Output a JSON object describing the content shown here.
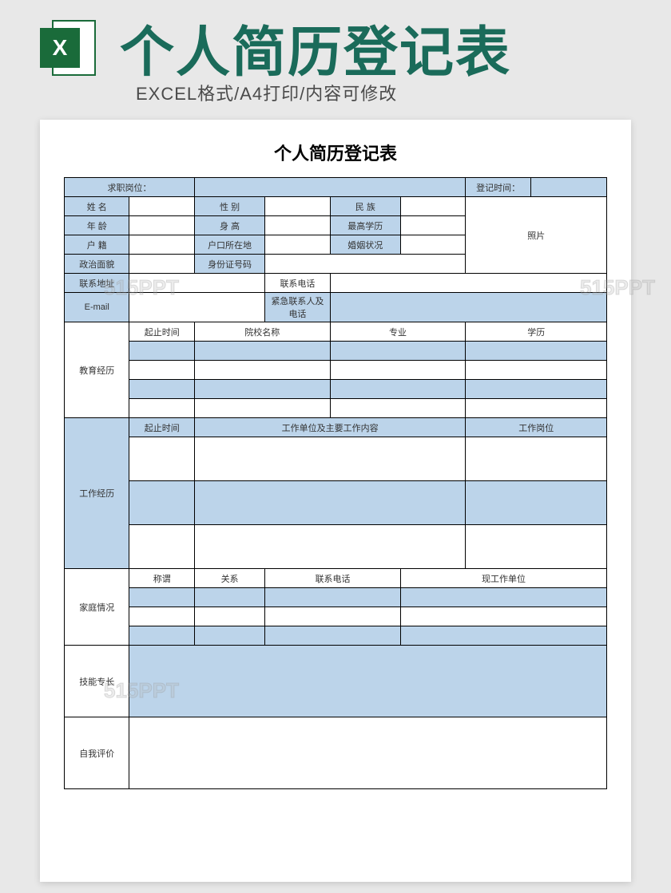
{
  "header": {
    "icon_letter": "X",
    "main_title": "个人简历登记表",
    "subtitle": "EXCEL格式/A4打印/内容可修改"
  },
  "doc": {
    "title": "个人简历登记表",
    "top_row": {
      "job_label": "求职岗位：",
      "date_label": "登记时间："
    },
    "info": {
      "name": "姓   名",
      "gender": "性   别",
      "ethnic": "民   族",
      "age": "年   龄",
      "height": "身   高",
      "edu": "最高学历",
      "huji": "户   籍",
      "hukou": "户口所在地",
      "marital": "婚姻状况",
      "politics": "政治面貌",
      "idcard": "身份证号码",
      "addr": "联系地址",
      "phone": "联系电话",
      "email": "E-mail",
      "emergency": "紧急联系人及电话",
      "photo": "照片"
    },
    "edu_section": {
      "label": "教育经历",
      "h1": "起止时间",
      "h2": "院校名称",
      "h3": "专业",
      "h4": "学历"
    },
    "work_section": {
      "label": "工作经历",
      "h1": "起止时间",
      "h2": "工作单位及主要工作内容",
      "h3": "工作岗位"
    },
    "family_section": {
      "label": "家庭情况",
      "h1": "称谓",
      "h2": "关系",
      "h3": "联系电话",
      "h4": "现工作单位"
    },
    "skills_label": "技能专长",
    "self_label": "自我评价"
  },
  "watermark": "515PPT"
}
